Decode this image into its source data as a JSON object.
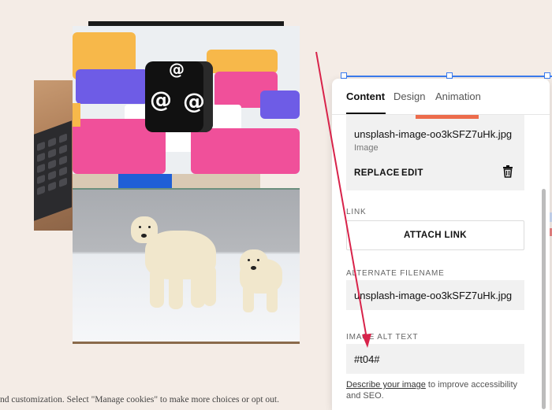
{
  "panel": {
    "tabs": [
      {
        "label": "Content",
        "active": true
      },
      {
        "label": "Design",
        "active": false
      },
      {
        "label": "Animation",
        "active": false
      }
    ],
    "file": {
      "name": "unsplash-image-oo3kSFZ7uHk.jpg",
      "type": "Image",
      "replace_label": "REPLACE",
      "edit_label": "EDIT",
      "delete_icon": "trash-icon"
    },
    "link": {
      "label": "LINK",
      "button_label": "ATTACH LINK"
    },
    "alternate_filename": {
      "label": "ALTERNATE FILENAME",
      "value": "unsplash-image-oo3kSFZ7uHk.jpg"
    },
    "alt_text": {
      "label": "IMAGE ALT TEXT",
      "value": "#t04#"
    },
    "helper": {
      "link_text": "Describe your image",
      "text": " to improve accessibility and SEO."
    }
  },
  "cookie_banner": {
    "text": "nd customization. Select \"Manage cookies\" to make more choices or opt out."
  },
  "colors": {
    "accent_progress": "#ec6c4c",
    "selection": "#3b7cf0",
    "annotation_arrow": "#d8234a"
  }
}
